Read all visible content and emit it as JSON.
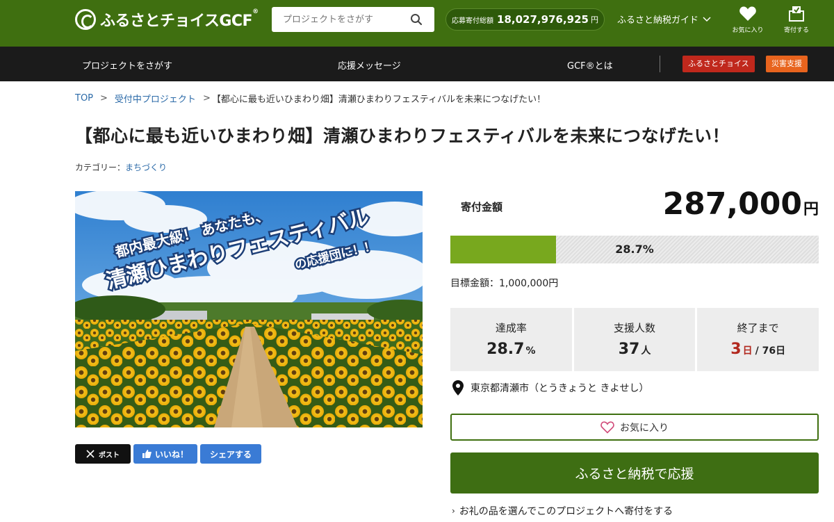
{
  "header": {
    "logo_text": "ふるさとチョイスGCF",
    "logo_reg": "®",
    "search_placeholder": "プロジェクトをさがす",
    "total_label": "応募寄付総額",
    "total_value": "18,027,976,925",
    "total_unit": "円",
    "guide_label": "ふるさと納税ガイド",
    "favorites_label": "お気に入り",
    "donate_label": "寄付する"
  },
  "nav": {
    "items": [
      "プロジェクトをさがす",
      "応援メッセージ",
      "GCF®とは"
    ],
    "badge_choice": "ふるさとチョイス",
    "badge_disaster": "災害支援"
  },
  "breadcrumb": {
    "top": "TOP",
    "accepting": "受付中プロジェクト",
    "current": "【都心に最も近いひまわり畑】清瀬ひまわりフェスティバルを未来につなげたい！",
    "sep": ">"
  },
  "project": {
    "title": "【都心に最も近いひまわり畑】清瀬ひまわりフェスティバルを未来につなげたい！",
    "category_label": "カテゴリー：",
    "category_value": "まちづくり"
  },
  "hero": {
    "line1": "都内最大級！ あなたも、",
    "line2": "清瀬ひまわりフェスティバル",
    "line3": "の応援団に！！"
  },
  "share": {
    "post": "ポスト",
    "like": "いいね！",
    "share": "シェアする"
  },
  "funding": {
    "label": "寄付金額",
    "amount": "287,000",
    "unit": "円",
    "progress_fraction": 0.287,
    "progress_text": "28.7%",
    "goal": "目標金額：1,000,000円",
    "stats": {
      "rate_label": "達成率",
      "rate_value": "28.7",
      "rate_unit": "%",
      "supporters_label": "支援人数",
      "supporters_value": "37",
      "supporters_unit": "人",
      "end_label": "終了まで",
      "end_days": "3",
      "end_unit": "日",
      "end_total": "/ 76日"
    },
    "location": "東京都清瀬市（とうきょうと きよせし）",
    "favorite_button": "お気に入り",
    "support_button": "ふるさと納税で応援",
    "gift_link": "お礼の品を選んでこのプロジェクトへ寄付をする"
  },
  "colors": {
    "header_green": "#3f6f10",
    "progress_green": "#78a81e",
    "button_green": "#3e6e13",
    "badge_red": "#c0281c",
    "badge_orange": "#e8641e",
    "link_blue": "#2b6aa8"
  },
  "icons": {
    "search": "search-icon",
    "heart": "heart-icon",
    "donate": "donate-box-icon",
    "pin": "location-pin-icon",
    "x": "x-logo-icon",
    "thumbs": "thumbs-up-icon",
    "chevron": "chevron-down-icon"
  }
}
